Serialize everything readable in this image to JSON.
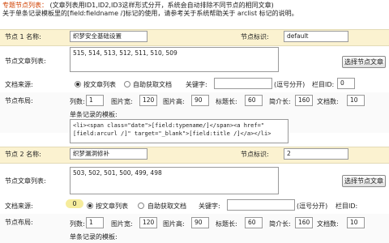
{
  "header": {
    "section_title": "专题节点列表：",
    "section_note": "(文章列表用ID1,ID2,ID3这样形式分开，系统会自动排除不同节点的相同文章)",
    "template_note": "关于单条记录模板里的[field:fieldname /]标记的使用，请参考关于系统帮助关于 arclist 标记的说明。"
  },
  "labels": {
    "doc_list": "节点文章列表:",
    "doc_source": "文档来源:",
    "by_list": "按文章列表",
    "auto_fetch": "自助获取文档",
    "keyword": "关键字:",
    "comma_sep_1": "(逗号分开)",
    "column_id_1": "栏目ID:",
    "comma_sep_2": "(逗号分开)",
    "column_id_2": "栏目ID:",
    "layout": "节点布局:",
    "columns": "列数:",
    "img_width": "图片宽:",
    "img_height": "图片高:",
    "title_len": "标题长:",
    "intro_len": "简介长:",
    "doc_count": "文档数:",
    "template": "单条记录的模板:",
    "select_button": "选择节点文章",
    "node_id": "节点标识:"
  },
  "node1": {
    "number_label": "节点 1 名称:",
    "name": "织梦安全基础设置",
    "node_id_value": "default",
    "articles": "515, 514, 513, 512, 511, 510, 509",
    "keyword_value": "",
    "column_id_value": "0",
    "columns": "1",
    "img_width": "120",
    "img_height": "90",
    "title_len": "60",
    "intro_len": "160",
    "doc_count": "10",
    "template_line1": "<li><span class=\"date\">[field:typename/]</span><a href=\"[field:arcurl /]\" target=\"_blank\">[field:title /]</a></li>"
  },
  "node2": {
    "number_label": "节点 2 名称:",
    "name": "织梦漏洞修补",
    "node_id_value": "2",
    "articles": "503, 502, 501, 500, 499, 498",
    "badge": "0",
    "keyword_value": "",
    "column_id_value": "",
    "columns": "1",
    "img_width": "120",
    "img_height": "90",
    "title_len": "60",
    "intro_len": "160",
    "doc_count": "10"
  }
}
